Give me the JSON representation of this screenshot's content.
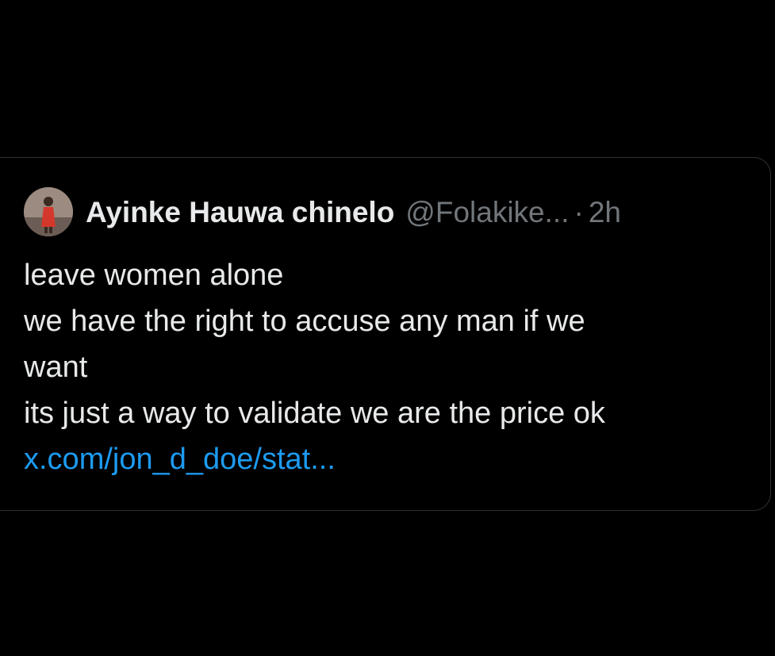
{
  "tweet": {
    "author": {
      "name": "Ayinke Hauwa chinelo",
      "handle": "@Folakike...",
      "avatar_icon": "profile-photo"
    },
    "separator": "·",
    "time": "2h",
    "lines": [
      "leave women alone",
      "we have the right to accuse any man if we",
      "want",
      "its just a way to validate we are the price ok"
    ],
    "link": "x.com/jon_d_doe/stat..."
  },
  "colors": {
    "background": "#000000",
    "card_border": "#2f3336",
    "primary_text": "#e7e9ea",
    "secondary_text": "#71767b",
    "link": "#1d9bf0"
  }
}
